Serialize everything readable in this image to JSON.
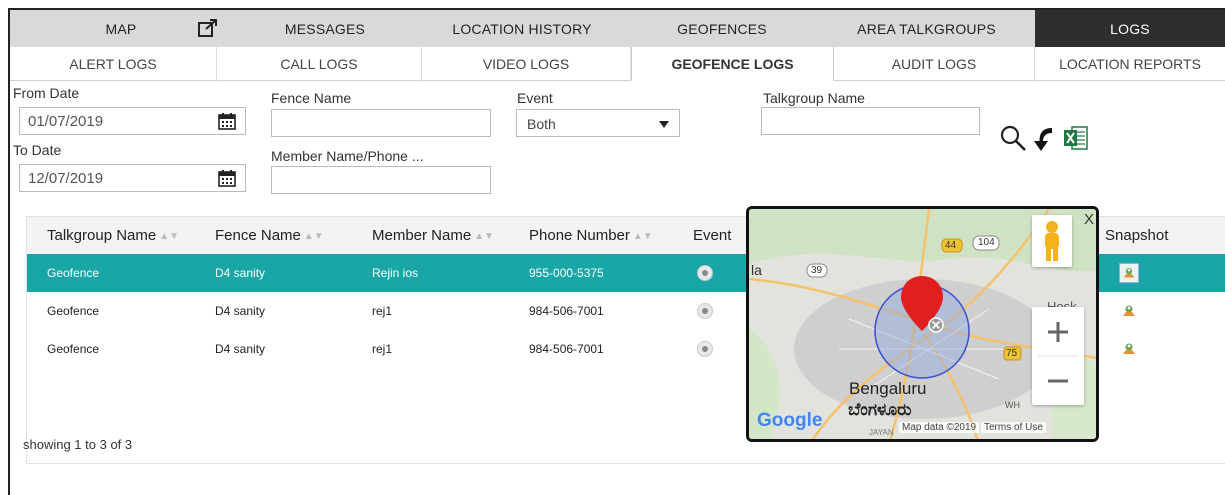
{
  "top_tabs": [
    {
      "label": "MAP"
    },
    {
      "label": "MESSAGES"
    },
    {
      "label": "LOCATION HISTORY"
    },
    {
      "label": "GEOFENCES"
    },
    {
      "label": "AREA TALKGROUPS"
    },
    {
      "label": "LOGS"
    }
  ],
  "sub_tabs": [
    {
      "label": "ALERT LOGS"
    },
    {
      "label": "CALL LOGS"
    },
    {
      "label": "VIDEO LOGS"
    },
    {
      "label": "GEOFENCE LOGS"
    },
    {
      "label": "AUDIT LOGS"
    },
    {
      "label": "LOCATION REPORTS"
    }
  ],
  "filters": {
    "from_date_label": "From Date",
    "from_date_value": "01/07/2019",
    "to_date_label": "To Date",
    "to_date_value": "12/07/2019",
    "fence_name_label": "Fence Name",
    "fence_name_value": "",
    "member_label": "Member Name/Phone ...",
    "member_value": "",
    "event_label": "Event",
    "event_value": "Both",
    "talkgroup_label": "Talkgroup Name",
    "talkgroup_value": ""
  },
  "table": {
    "headers": [
      "Talkgroup Name",
      "Fence Name",
      "Member Name",
      "Phone Number",
      "Event",
      "Snapshot"
    ],
    "rows": [
      {
        "talkgroup": "Geofence",
        "fence": "D4 sanity",
        "member": "Rejin ios",
        "phone": "955-000-5375"
      },
      {
        "talkgroup": "Geofence",
        "fence": "D4 sanity",
        "member": "rej1",
        "phone": "984-506-7001"
      },
      {
        "talkgroup": "Geofence",
        "fence": "D4 sanity",
        "member": "rej1",
        "phone": "984-506-7001"
      }
    ],
    "footer": "showing 1 to 3 of 3"
  },
  "map": {
    "labels": {
      "city_en": "Bengaluru",
      "city_kn": "ಬೆಂಗಳೂರು",
      "partial_left": "la",
      "road_39": "39",
      "road_44": "44",
      "road_104": "104",
      "road_75": "75",
      "partial_hosk": "Hosk",
      "partial_wh": "WH",
      "partial_bottom": "JAYAN",
      "map_data": "Map data ©2019",
      "terms": "Terms of Use",
      "google": "Google",
      "close": "X"
    }
  },
  "colors": {
    "selected_row": "#18a6a6",
    "active_tab": "#2e2e2e"
  }
}
